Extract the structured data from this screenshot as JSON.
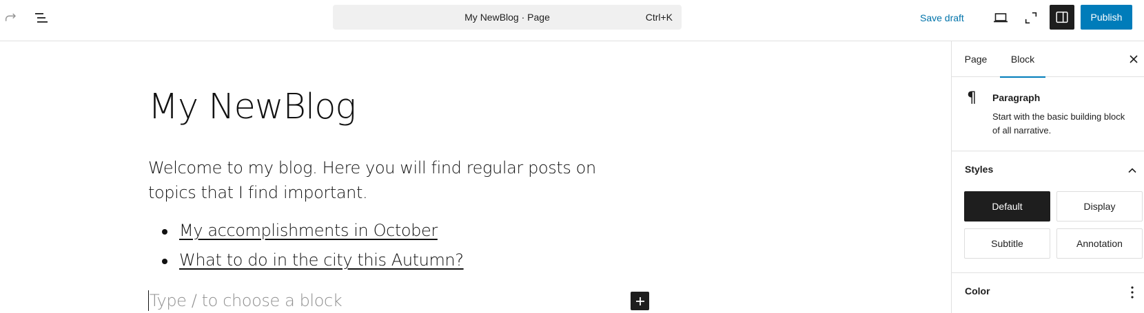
{
  "toolbar": {
    "redo_icon": "redo-icon",
    "document_overview_icon": "list-view-icon",
    "command": {
      "title": "My NewBlog · Page",
      "shortcut": "Ctrl+K"
    },
    "save_draft_label": "Save draft",
    "preview_icon": "desktop-preview-icon",
    "fullscreen_icon": "fullscreen-icon",
    "settings_icon": "sidebar-settings-icon",
    "publish_label": "Publish"
  },
  "editor": {
    "title": "My NewBlog",
    "intro": "Welcome to my blog. Here you will find regular posts on topics that I find important.",
    "links": [
      "My accomplishments in October",
      "What to do in the city this Autumn?"
    ],
    "placeholder": "Type / to choose a block",
    "add_block_icon": "plus-icon"
  },
  "sidebar": {
    "tabs": [
      "Page",
      "Block"
    ],
    "active_tab": "Block",
    "close_icon": "close-icon",
    "block": {
      "icon": "paragraph-icon",
      "name": "Paragraph",
      "description": "Start with the basic building block of all narrative."
    },
    "styles": {
      "title": "Styles",
      "options": [
        "Default",
        "Display",
        "Subtitle",
        "Annotation"
      ],
      "selected": "Default"
    },
    "color": {
      "title": "Color"
    }
  },
  "colors": {
    "accent": "#007cba",
    "link": "#0073aa",
    "dark": "#1e1e1e"
  }
}
